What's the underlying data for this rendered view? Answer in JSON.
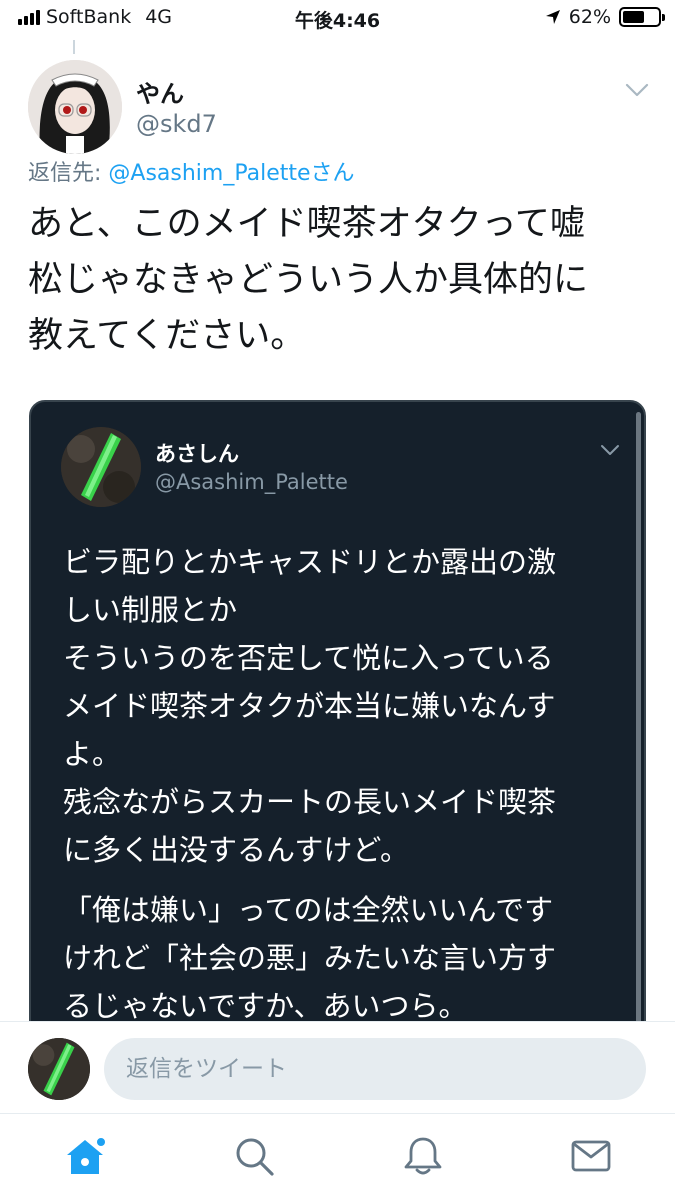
{
  "status_bar": {
    "carrier": "SoftBank",
    "network": "4G",
    "time": "午後4:46",
    "battery": "62%",
    "battery_level": 0.62
  },
  "tweet": {
    "author_name": "やん",
    "author_handle": "@skd7",
    "reply_prefix": "返信先: ",
    "reply_mention": "@Asashim_Palette",
    "reply_suffix": "さん",
    "text_lines": [
      "あと、このメイド喫茶オタクって嘘",
      "松じゃなきゃどういう人か具体的に",
      "教えてください。"
    ]
  },
  "quoted_tweet": {
    "author_name": "あさしん",
    "author_handle": "@Asashim_Palette",
    "text_lines": [
      "ビラ配りとかキャスドリとか露出の激",
      "しい制服とか",
      "そういうのを否定して悦に入っている",
      "メイド喫茶オタクが本当に嫌いなんす",
      "よ。",
      "残念ながらスカートの長いメイド喫茶",
      "に多く出没するんすけど。",
      "「俺は嫌い」ってのは全然いいんです",
      "けれど「社会の悪」みたいな言い方す",
      "るじゃないですか、あいつら。"
    ]
  },
  "reply_bar": {
    "placeholder": "返信をツイート"
  },
  "tab_bar": {
    "items": [
      "home-icon",
      "search-icon",
      "notifications-icon",
      "messages-icon"
    ],
    "active": "home",
    "accent_color": "#1da1f2",
    "inactive_color": "#657786"
  }
}
